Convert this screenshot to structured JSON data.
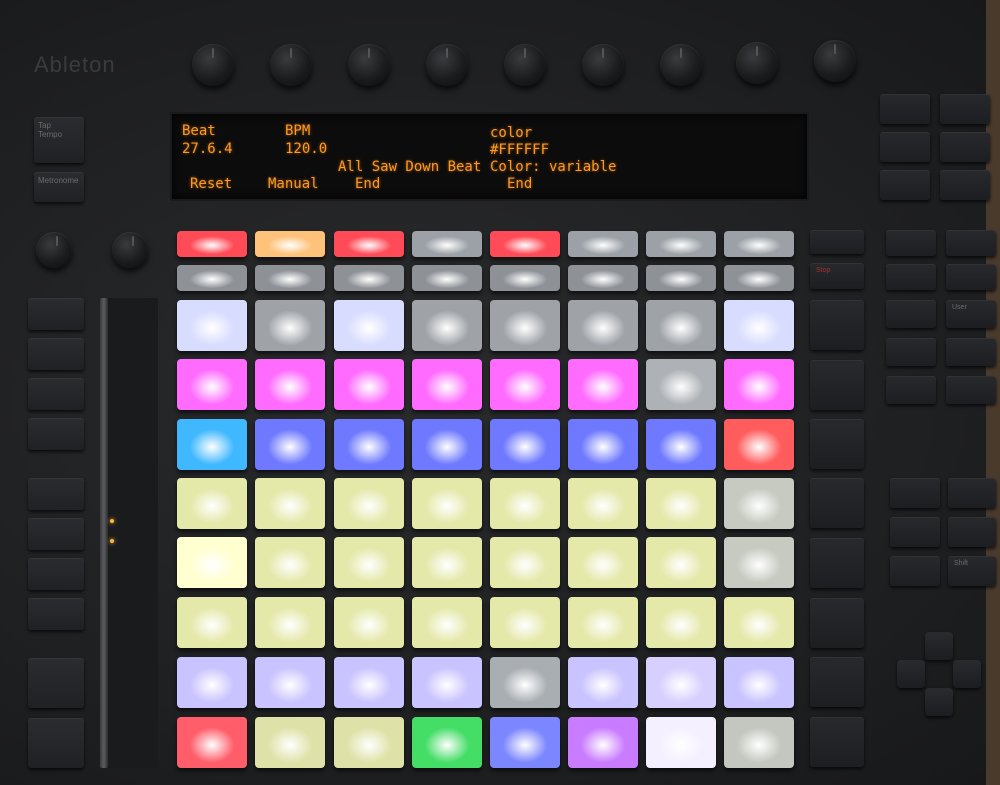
{
  "brand": {
    "logo_text": "Ableton"
  },
  "left_buttons": {
    "tap_tempo": "Tap\nTempo",
    "metronome": "Metronome"
  },
  "display": {
    "col1": {
      "header": "Beat",
      "value": "27.6.4",
      "soft": "Reset"
    },
    "col2": {
      "header": "BPM",
      "value": "120.0",
      "soft": "Manual"
    },
    "col3": {
      "header": "",
      "value": "All Saw Down Beat",
      "soft": "End"
    },
    "col4": {
      "header": "color",
      "value": "#FFFFFF",
      "detail": "Color: variable",
      "soft": "End"
    }
  },
  "right_labels": {
    "stop": "Stop",
    "user": "User",
    "shift": "Shift"
  },
  "pad_colors": {
    "top_row_1": [
      "#ff4b57",
      "#ffc27a",
      "#ff4b57",
      "#9ba1a6",
      "#ff4b57",
      "#9ba1a6",
      "#9ba1a6",
      "#9ba1a6"
    ],
    "top_row_2": [
      "#8e9297",
      "#8e9297",
      "#8e9297",
      "#8e9297",
      "#8e9297",
      "#8e9297",
      "#8e9297",
      "#8e9297"
    ],
    "grid": [
      [
        "#d8dcff",
        "#9fa3a8",
        "#d8dcff",
        "#9fa3a8",
        "#9fa3a8",
        "#9fa3a8",
        "#9fa3a8",
        "#d8dcff"
      ],
      [
        "#ff6bff",
        "#ff6bff",
        "#ff6bff",
        "#ff6bff",
        "#ff6bff",
        "#ff6bff",
        "#aeb2b6",
        "#ff6bff"
      ],
      [
        "#40b8ff",
        "#6e79ff",
        "#6e79ff",
        "#6e79ff",
        "#6e79ff",
        "#6e79ff",
        "#6e79ff",
        "#ff5d5d"
      ],
      [
        "#e4e8a8",
        "#e4e8a8",
        "#e4e8a8",
        "#e4e8a8",
        "#e4e8a8",
        "#e4e8a8",
        "#e4e8a8",
        "#c6cac0"
      ],
      [
        "#ffffd0",
        "#e4e8a8",
        "#e4e8a8",
        "#e4e8a8",
        "#e4e8a8",
        "#e4e8a8",
        "#e4e8a8",
        "#c6cac0"
      ],
      [
        "#e4e8a8",
        "#e4e8a8",
        "#e4e8a8",
        "#e4e8a8",
        "#e4e8a8",
        "#e4e8a8",
        "#e4e8a8",
        "#e4e8a8"
      ],
      [
        "#c9c3ff",
        "#c9c3ff",
        "#c9c3ff",
        "#c9c3ff",
        "#a9aeb3",
        "#c9c3ff",
        "#d7d0ff",
        "#c9c3ff"
      ],
      [
        "#ff5d6a",
        "#dfe2a8",
        "#dfe2a8",
        "#44dd66",
        "#7c86ff",
        "#c97cff",
        "#f4f0ff",
        "#c3c7bf"
      ]
    ]
  }
}
